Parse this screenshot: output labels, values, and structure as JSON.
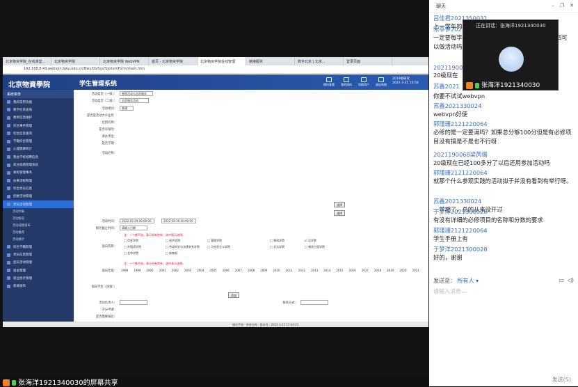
{
  "browser": {
    "tabs": [
      "北京物资学院_在线课堂...",
      "北京物资学院",
      "北京物资学院 WebVPN",
      "首页 - 北京物资学院",
      "北京物资学院在线管理",
      "链接服务",
      "数字北京 | 北京...",
      "登录页面"
    ],
    "url": "192.168.8.43.webvpn.bwu.edu.cn/BwuXG/Sys/SystemForm/main.htm"
  },
  "app": {
    "logo": "北京物資學院",
    "system_title": "学生管理系统",
    "top_icons": [
      "模块查看",
      "我的资料",
      "切换用户",
      "退出系统"
    ],
    "user": [
      "2019级研究",
      "2022-3-25 10:58"
    ],
    "sidebar_header": "系统菜单",
    "sidebar_items": [
      "我的常用功能",
      "教学信息查询",
      "教师信息维护",
      "综合事务管理",
      "综合信息查询",
      "学籍综合管理",
      "心理健康统计",
      "我会学校招聘信息",
      "就业成绩管理系统",
      "离校管理事务",
      "办事流程管理",
      "综合党员信息",
      "团委活动管理",
      "党员活动管理"
    ],
    "sidebar_sub": [
      "活动列表",
      "活动报名",
      "活动成绩发布",
      "活动推荐",
      "活动统计"
    ],
    "sidebar_items_after": [
      "综合学籍管理",
      "党员信息管理",
      "团员活动管理",
      "宿舍管理",
      "就业统计管理",
      "新闻发布"
    ]
  },
  "form": {
    "labels": [
      "活动类型（一级）：",
      "活动类型（二级）：",
      "活动级别：",
      "是否是活动大众业务：",
      "社团名称：",
      "是否有保险：",
      "承办单位：",
      "是否学期：",
      "活动名称：",
      "活动时间：",
      "报名截止时间：",
      "面向院系：",
      "面向年级：",
      "面向学生（班级）：",
      "活动负责人：",
      "联系方式：",
      "学分申请：",
      "是否需要报名：",
      "是否允许重复报名：",
      "是否显示活动结果：",
      "活动结果备注：",
      "活动内容："
    ],
    "values": [
      "感恩活动与志愿服务",
      "志愿服务活动",
      "普通",
      "2022-03-29 00:00:00",
      "2022-04-30 00:00:00",
      "请输入日期"
    ],
    "select_btn": "选择",
    "add_btn": "添加",
    "red_hint": "注：一个都不选，表示所有院系；选中表示选择。",
    "schools": [
      "信息学院",
      "经济学院",
      "管理学院",
      "物流学院",
      "法学院",
      "外国语学院",
      "劳动科学与法律关系学院",
      "马克思主义学院",
      "文法学院",
      "物流工程学院",
      "艺术学院",
      "体育部"
    ],
    "years": [
      "1998",
      "1999",
      "2000",
      "2001",
      "2002",
      "2003",
      "2004",
      "2005",
      "2006",
      "2007",
      "2008",
      "2009",
      "2010",
      "2011",
      "2012",
      "2013",
      "2014",
      "2015",
      "2016",
      "2017",
      "2018",
      "2019",
      "2020",
      "2021"
    ],
    "status_bar": "操作手册 · 系统名称 · 版本号 · 2022-3-25 15:44:41"
  },
  "chat": {
    "title": "聊天",
    "messages": [
      {
        "sender": "吕佳君2021350031",
        "text": "上一学年的"
      },
      {
        "sender": "宋亭伊2021",
        "text": "一定要每学期都满足三条才可以吗 移100分，大四可以做活动吗"
      },
      {
        "sender": "20211900",
        "text": "20级现在"
      },
      {
        "sender": "苏鑫2021",
        "text": ""
      },
      {
        "sender": "",
        "text": "你要不试试webvpn"
      },
      {
        "sender": "苏鑫2021330024",
        "text": "webvpn好使"
      },
      {
        "sender": "郭瑾珊2121220064",
        "text": "必修的是一定要满吗？如果总分够100分但是有必修项目没有搞是不是也不行呀"
      },
      {
        "sender": "2021190068梁芮璐",
        "text": "20级现在已经100多分了以后还用参加活动吗"
      },
      {
        "sender": "郭瑾珊2121220064",
        "text": "就那个什么参观实践的活动拟于并没有看到有举行呀。"
      },
      {
        "sender": "苏鑫2021330024",
        "text": "一学期了，总的从来没开过"
      },
      {
        "sender": "于梦洋2021300028",
        "text": "有没有详细的必修项目的名称和分数的要求"
      },
      {
        "sender": "郭瑾珊2121220064",
        "text": "学生手册上有"
      },
      {
        "sender": "于梦洋2021300028",
        "text": "好的，谢谢"
      }
    ],
    "send_to_label": "发送至：",
    "send_to_value": "所有人",
    "input_placeholder": "请输入消息...",
    "send_button": "发送(S)"
  },
  "video": {
    "speaking_label": "正在讲话：张海洋1921340030",
    "name": "张海洋1921340030"
  },
  "share": {
    "text": "张海洋1921340030的屏幕共享"
  }
}
